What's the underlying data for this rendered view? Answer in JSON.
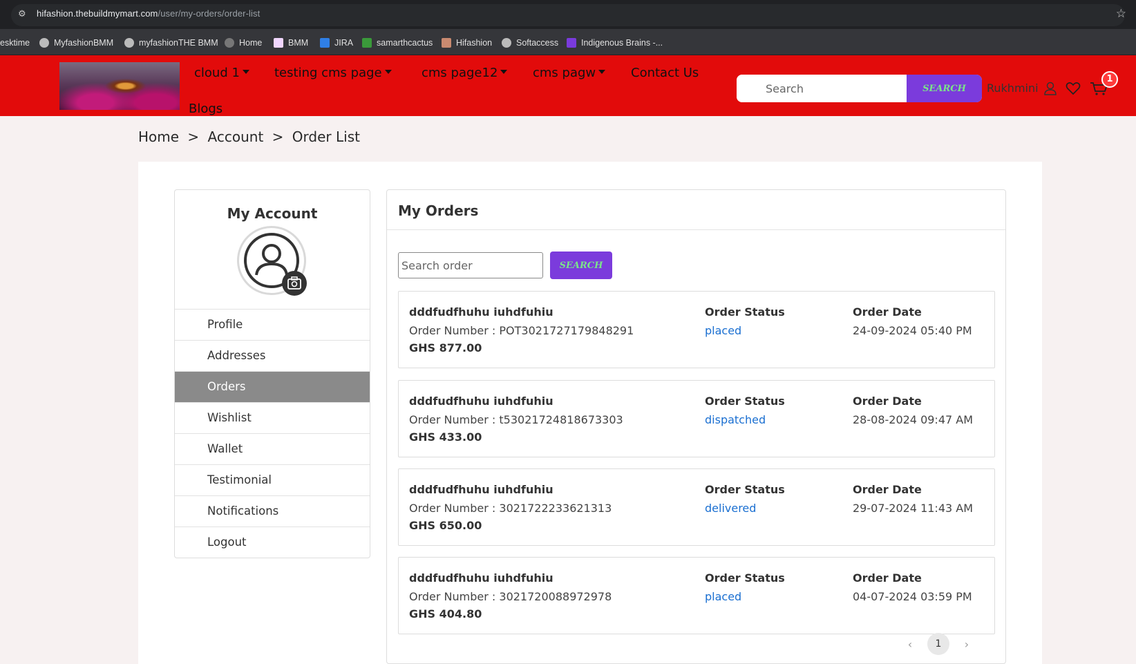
{
  "browser": {
    "url_host": "hifashion.thebuildmymart.com",
    "url_path": "/user/my-orders/order-list",
    "bookmarks": [
      {
        "label": "esktime",
        "icon": "none"
      },
      {
        "label": "MyfashionBMM",
        "icon": "globe-icon"
      },
      {
        "label": "myfashionTHE BMM",
        "icon": "globe-icon"
      },
      {
        "label": "Home",
        "icon": "globe-icon"
      },
      {
        "label": "BMM",
        "icon": "bmm-icon"
      },
      {
        "label": "JIRA",
        "icon": "jira-icon"
      },
      {
        "label": "samarthcactus",
        "icon": "cactus-icon"
      },
      {
        "label": "Hifashion",
        "icon": "fashion-icon"
      },
      {
        "label": "Softaccess",
        "icon": "globe-icon"
      },
      {
        "label": "Indigenous Brains -...",
        "icon": "brain-icon"
      }
    ]
  },
  "header": {
    "nav": {
      "cloud1": "cloud 1",
      "testing_cms": "testing cms page",
      "cms_page12": "cms page12",
      "cms_pagw": "cms pagw",
      "contact": "Contact Us",
      "blogs": "Blogs"
    },
    "search_placeholder": "Search",
    "search_button": "SEARCH",
    "username": "Rukhmini",
    "cart_count": "1"
  },
  "breadcrumb": {
    "home": "Home",
    "sep": ">",
    "account": "Account",
    "current": "Order List"
  },
  "account": {
    "title": "My Account",
    "menu": [
      "Profile",
      "Addresses",
      "Orders",
      "Wishlist",
      "Wallet",
      "Testimonial",
      "Notifications",
      "Logout"
    ],
    "active": "Orders"
  },
  "orders": {
    "title": "My Orders",
    "search_placeholder": "Search order",
    "search_button": "SEARCH",
    "status_label": "Order Status",
    "date_label": "Order Date",
    "list": [
      {
        "name": "dddfudfhuhu iuhdfuhiu",
        "number": "Order Number : POT3021727179848291",
        "total": "GHS 877.00",
        "status": "placed",
        "date": "24-09-2024 05:40 PM"
      },
      {
        "name": "dddfudfhuhu iuhdfuhiu",
        "number": "Order Number : t53021724818673303",
        "total": "GHS 433.00",
        "status": "dispatched",
        "date": "28-08-2024 09:47 AM"
      },
      {
        "name": "dddfudfhuhu iuhdfuhiu",
        "number": "Order Number : 3021722233621313",
        "total": "GHS 650.00",
        "status": "delivered",
        "date": "29-07-2024 11:43 AM"
      },
      {
        "name": "dddfudfhuhu iuhdfuhiu",
        "number": "Order Number : 3021720088972978",
        "total": "GHS 404.80",
        "status": "placed",
        "date": "04-07-2024 03:59 PM"
      }
    ],
    "pagination": {
      "current": "1",
      "prev": "‹",
      "next": "›"
    }
  },
  "colors": {
    "header_bg": "#e20b0b",
    "accent": "#7b3bdc",
    "search_text": "#7be38a",
    "status_link": "#1a6fd1",
    "active_menu": "#8a8a8a"
  }
}
